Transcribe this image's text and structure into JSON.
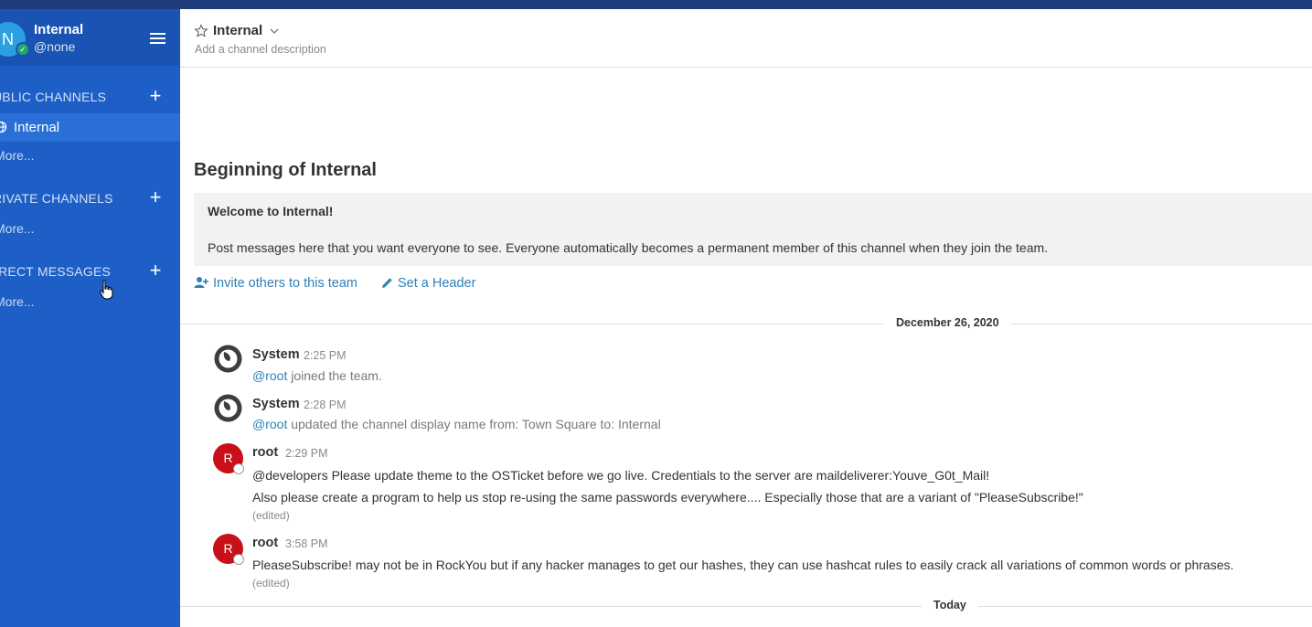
{
  "sidebar": {
    "avatar_letter": "N",
    "team_name": "Internal",
    "username": "@none",
    "public_title": "UBLIC CHANNELS",
    "private_title": "RIVATE CHANNELS",
    "direct_title": "IRECT MESSAGES",
    "channels": [
      {
        "label": "Internal"
      }
    ],
    "more_public": "More...",
    "more_private": "More...",
    "more_direct": "More..."
  },
  "header": {
    "title": "Internal",
    "description": "Add a channel description"
  },
  "intro": {
    "title": "Beginning of Internal",
    "welcome": "Welcome to Internal!",
    "description": "Post messages here that you want everyone to see. Everyone automatically becomes a permanent member of this channel when they join the team.",
    "invite_label": "Invite others to this team",
    "set_header_label": "Set a Header"
  },
  "dates": {
    "first": "December 26, 2020",
    "second": "Today"
  },
  "posts": [
    {
      "user": "System",
      "time": "2:25 PM",
      "mention": "@root",
      "text": " joined the team."
    },
    {
      "user": "System",
      "time": "2:28 PM",
      "mention": "@root",
      "text": " updated the channel display name from: Town Square to: Internal"
    },
    {
      "user": "root",
      "avatar": "R",
      "time": "2:29 PM",
      "line1": "@developers Please update theme to the OSTicket before we go live.  Credentials to the server are maildeliverer:Youve_G0t_Mail!",
      "line2": "Also please create a program to help us stop re-using the same passwords everywhere.... Especially those that are a variant of \"PleaseSubscribe!\"",
      "edited": "(edited)"
    },
    {
      "user": "root",
      "avatar": "R",
      "time": "3:58 PM",
      "line1": "PleaseSubscribe! may not be in RockYou but if any hacker manages to get our hashes, they can use hashcat rules to easily crack all variations of common words or phrases.",
      "edited": "(edited)"
    }
  ],
  "colors": {
    "sidebar_bg": "#1d5fc6",
    "sidebar_header": "#1953b3",
    "link": "#2f81b7",
    "online": "#21a868",
    "root_avatar": "#c8101a"
  }
}
